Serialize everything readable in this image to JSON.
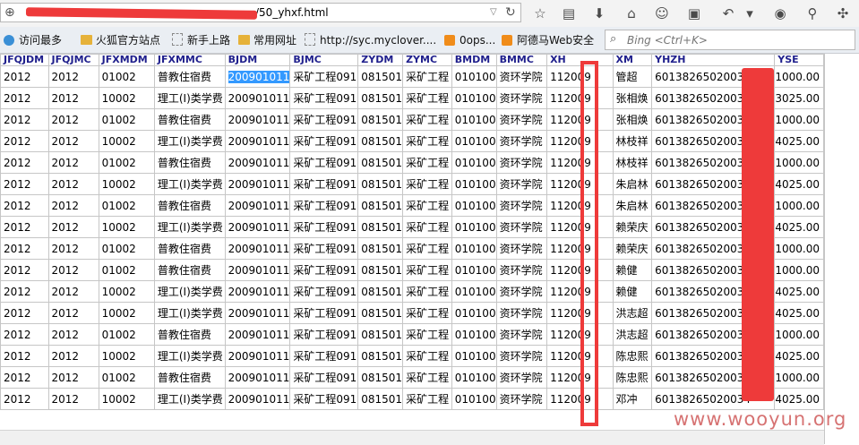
{
  "browser": {
    "url_visible": "/50_yhxf.html",
    "bookmarks": [
      {
        "label": "访问最多",
        "icon": "gear-icon"
      },
      {
        "label": "火狐官方站点",
        "icon": "folder-icon"
      },
      {
        "label": "新手上路",
        "icon": "page-icon"
      },
      {
        "label": "常用网址",
        "icon": "folder-icon"
      },
      {
        "label": "http://syc.myclover....",
        "icon": "page-icon"
      },
      {
        "label": "0ops...",
        "icon": "rss-icon"
      },
      {
        "label": "阿德马Web安全",
        "icon": "rss-icon"
      }
    ],
    "search_placeholder": "Bing <Ctrl+K>"
  },
  "table": {
    "headers": [
      "JFQJDM",
      "JFQJMC",
      "JFXMDM",
      "JFXMMC",
      "BJDM",
      "BJMC",
      "ZYDM",
      "ZYMC",
      "BMDM",
      "BMMC",
      "XH",
      "XM",
      "YHZH",
      "YSE"
    ],
    "rows": [
      [
        "2012",
        "2012",
        "01002",
        "普教住宿费",
        "200901011",
        "采矿工程091",
        "081501",
        "采矿工程",
        "010100",
        "资环学院",
        "112009",
        "管超",
        "60138265020034",
        "1000.00"
      ],
      [
        "2012",
        "2012",
        "10002",
        "理工(I)类学费",
        "200901011",
        "采矿工程091",
        "081501",
        "采矿工程",
        "010100",
        "资环学院",
        "112009",
        "张相焕",
        "60138265020034",
        "3025.00"
      ],
      [
        "2012",
        "2012",
        "01002",
        "普教住宿费",
        "200901011",
        "采矿工程091",
        "081501",
        "采矿工程",
        "010100",
        "资环学院",
        "112009",
        "张相焕",
        "60138265020034",
        "1000.00"
      ],
      [
        "2012",
        "2012",
        "10002",
        "理工(I)类学费",
        "200901011",
        "采矿工程091",
        "081501",
        "采矿工程",
        "010100",
        "资环学院",
        "112009",
        "林枝祥",
        "60138265020034",
        "4025.00"
      ],
      [
        "2012",
        "2012",
        "01002",
        "普教住宿费",
        "200901011",
        "采矿工程091",
        "081501",
        "采矿工程",
        "010100",
        "资环学院",
        "112009",
        "林枝祥",
        "60138265020034",
        "1000.00"
      ],
      [
        "2012",
        "2012",
        "10002",
        "理工(I)类学费",
        "200901011",
        "采矿工程091",
        "081501",
        "采矿工程",
        "010100",
        "资环学院",
        "112009",
        "朱启林",
        "60138265020034",
        "4025.00"
      ],
      [
        "2012",
        "2012",
        "01002",
        "普教住宿费",
        "200901011",
        "采矿工程091",
        "081501",
        "采矿工程",
        "010100",
        "资环学院",
        "112009",
        "朱启林",
        "60138265020034",
        "1000.00"
      ],
      [
        "2012",
        "2012",
        "10002",
        "理工(I)类学费",
        "200901011",
        "采矿工程091",
        "081501",
        "采矿工程",
        "010100",
        "资环学院",
        "112009",
        "赖荣庆",
        "60138265020034",
        "4025.00"
      ],
      [
        "2012",
        "2012",
        "01002",
        "普教住宿费",
        "200901011",
        "采矿工程091",
        "081501",
        "采矿工程",
        "010100",
        "资环学院",
        "112009",
        "赖荣庆",
        "60138265020034",
        "1000.00"
      ],
      [
        "2012",
        "2012",
        "01002",
        "普教住宿费",
        "200901011",
        "采矿工程091",
        "081501",
        "采矿工程",
        "010100",
        "资环学院",
        "112009",
        "赖健",
        "60138265020034",
        "1000.00"
      ],
      [
        "2012",
        "2012",
        "10002",
        "理工(I)类学费",
        "200901011",
        "采矿工程091",
        "081501",
        "采矿工程",
        "010100",
        "资环学院",
        "112009",
        "赖健",
        "60138265020034",
        "4025.00"
      ],
      [
        "2012",
        "2012",
        "10002",
        "理工(I)类学费",
        "200901011",
        "采矿工程091",
        "081501",
        "采矿工程",
        "010100",
        "资环学院",
        "112009",
        "洪志超",
        "60138265020034",
        "4025.00"
      ],
      [
        "2012",
        "2012",
        "01002",
        "普教住宿费",
        "200901011",
        "采矿工程091",
        "081501",
        "采矿工程",
        "010100",
        "资环学院",
        "112009",
        "洪志超",
        "60138265020034",
        "1000.00"
      ],
      [
        "2012",
        "2012",
        "10002",
        "理工(I)类学费",
        "200901011",
        "采矿工程091",
        "081501",
        "采矿工程",
        "010100",
        "资环学院",
        "112009",
        "陈忠熙",
        "60138265020034",
        "4025.00"
      ],
      [
        "2012",
        "2012",
        "01002",
        "普教住宿费",
        "200901011",
        "采矿工程091",
        "081501",
        "采矿工程",
        "010100",
        "资环学院",
        "112009",
        "陈忠熙",
        "60138265020034",
        "1000.00"
      ],
      [
        "2012",
        "2012",
        "10002",
        "理工(I)类学费",
        "200901011",
        "采矿工程091",
        "081501",
        "采矿工程",
        "010100",
        "资环学院",
        "112009",
        "邓冲",
        "60138265020034",
        "4025.00"
      ]
    ]
  },
  "watermark": "www.wooyun.org",
  "colors": {
    "redaction": "#ee3a3a",
    "header_text": "#1f1f8c",
    "selection": "#3399ff"
  }
}
